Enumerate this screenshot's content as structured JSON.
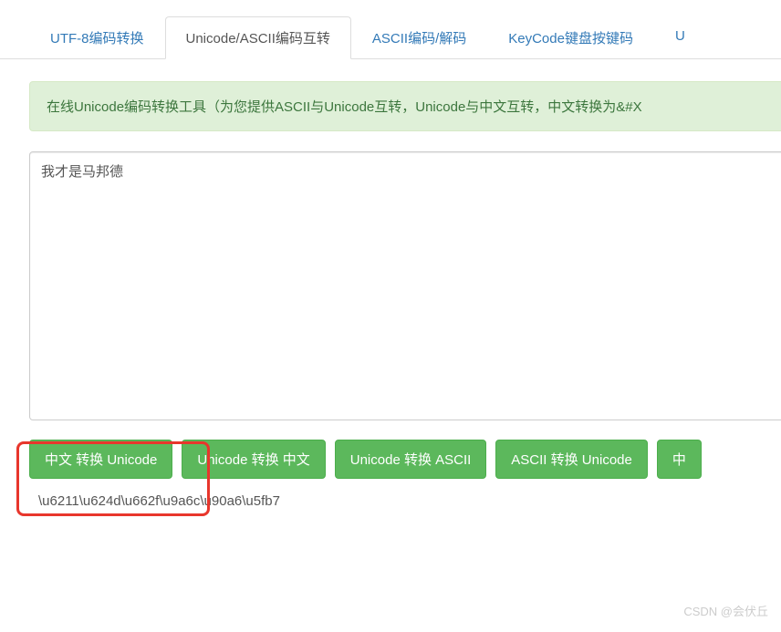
{
  "tabs": {
    "items": [
      {
        "label": "UTF-8编码转换",
        "active": false
      },
      {
        "label": "Unicode/ASCII编码互转",
        "active": true
      },
      {
        "label": "ASCII编码/解码",
        "active": false
      },
      {
        "label": "KeyCode键盘按键码",
        "active": false
      },
      {
        "label": "U",
        "active": false
      }
    ]
  },
  "alert": {
    "text": "在线Unicode编码转换工具（为您提供ASCII与Unicode互转，Unicode与中文互转，中文转换为&#X"
  },
  "input": {
    "value": "我才是马邦德"
  },
  "buttons": {
    "b1": "中文 转换 Unicode",
    "b2": "Unicode 转换 中文",
    "b3": "Unicode 转换 ASCII",
    "b4": "ASCII 转换 Unicode",
    "b5": "中"
  },
  "output": {
    "text": "\\u6211\\u624d\\u662f\\u9a6c\\u90a6\\u5fb7"
  },
  "watermark": {
    "text": "CSDN @会伏丘"
  }
}
